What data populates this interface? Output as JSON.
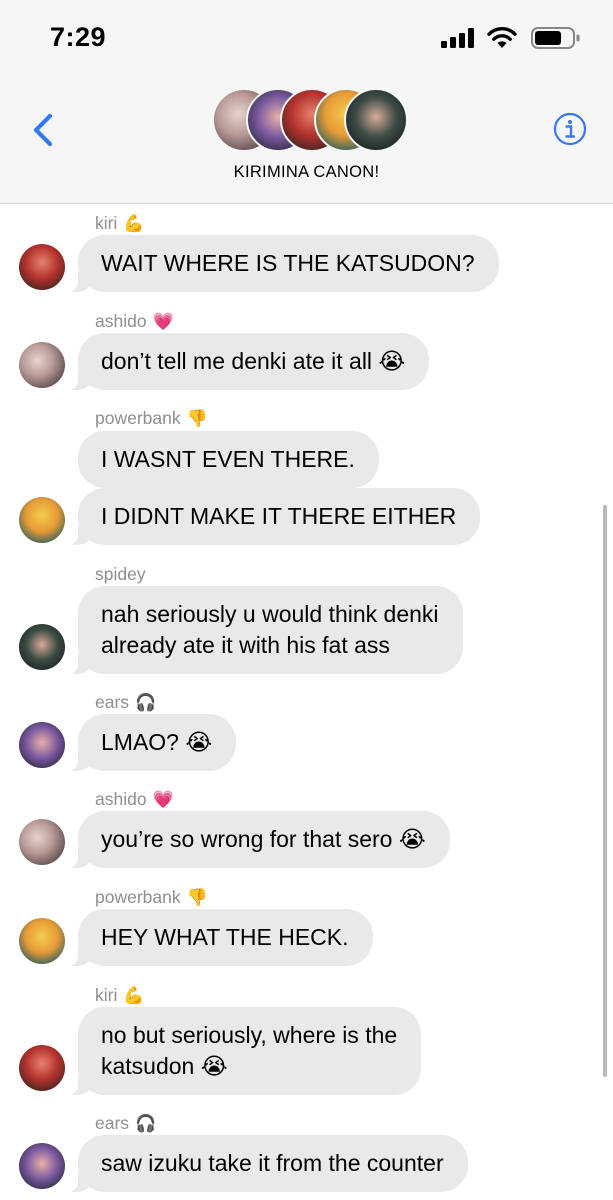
{
  "status_bar": {
    "time": "7:29"
  },
  "header": {
    "title": "KIRIMINA CANON!"
  },
  "colors": {
    "accent": "#3478f6",
    "bubble": "#e9e9eb",
    "sender": "#8e8e93"
  },
  "messages": [
    {
      "sender": "kiri",
      "sender_emoji": "💪",
      "text": "WAIT WHERE IS THE KATSUDON?",
      "avatar": "kiri-avatar"
    },
    {
      "sender": "ashido",
      "sender_emoji": "💗",
      "text": "don’t tell me denki ate it all 😭",
      "avatar": "ashido-avatar"
    },
    {
      "sender": "powerbank",
      "sender_emoji": "👎",
      "text": "I WASNT EVEN THERE.",
      "avatar": ""
    },
    {
      "sender": "",
      "sender_emoji": "",
      "text": "I DIDNT MAKE IT THERE EITHER",
      "avatar": "powerbank-avatar"
    },
    {
      "sender": "spidey",
      "sender_emoji": "",
      "text_line1": "nah seriously u would think denki",
      "text_line2": "already ate it with his fat ass",
      "avatar": "spidey-avatar"
    },
    {
      "sender": "ears",
      "sender_emoji": "🎧",
      "text": "LMAO? 😭",
      "avatar": "ears-avatar"
    },
    {
      "sender": "ashido",
      "sender_emoji": "💗",
      "text": "you’re so wrong for that sero 😭",
      "avatar": "ashido-avatar"
    },
    {
      "sender": "powerbank",
      "sender_emoji": "👎",
      "text": "HEY WHAT THE HECK.",
      "avatar": "powerbank-avatar"
    },
    {
      "sender": "kiri",
      "sender_emoji": "💪",
      "text_line1": "no but seriously, where is the",
      "text_line2": "katsudon 😭",
      "avatar": "kiri-avatar"
    },
    {
      "sender": "ears",
      "sender_emoji": "🎧",
      "text": "saw izuku take it from the counter",
      "avatar": "ears-avatar"
    }
  ]
}
